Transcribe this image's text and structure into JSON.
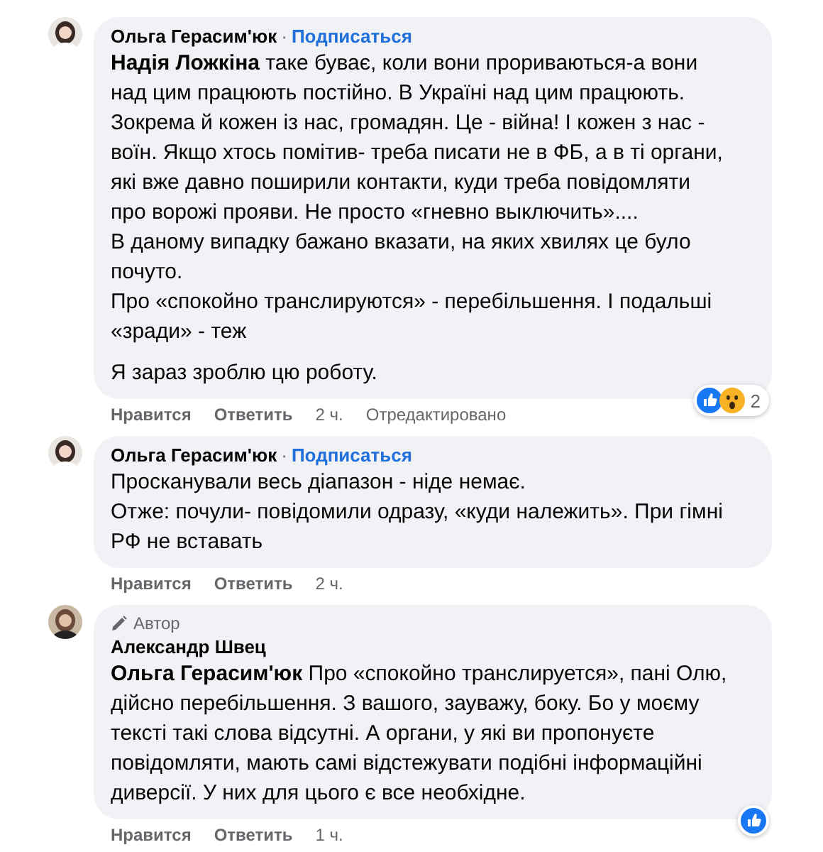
{
  "comments": [
    {
      "author": "Ольга Герасим'юк",
      "separator": "·",
      "follow": "Подписаться",
      "blocks": [
        [
          "**Надія Ложкіна** таке буває, коли вони прориваються-а вони над цим працюють постійно. В Україні над цим працюють. Зокрема й кожен із нас, громадян. Це - війна! І кожен з нас - воїн. Якщо хтось помітив- треба писати не в ФБ, а в ті органи, які вже давно поширили контакти, куди треба повідомляти про ворожі прояви. Не просто «гневно выключить»....",
          "В даному випадку бажано вказати, на яких хвилях це було почуто.",
          "Про «спокойно транслируются» - перебільшення. І подальші «зради» - теж"
        ],
        [
          "Я зараз зроблю цю роботу."
        ]
      ],
      "reactions": {
        "items": [
          {
            "kind": "like"
          },
          {
            "kind": "wow"
          }
        ],
        "count": "2"
      },
      "actions": [
        "Нравится",
        "Ответить"
      ],
      "time": "2 ч.",
      "edited": "Отредактировано"
    },
    {
      "author": "Ольга Герасим'юк",
      "separator": "·",
      "follow": "Подписаться",
      "blocks": [
        [
          "Просканували весь діапазон - ніде немає.",
          "Отже: почули- повідомили одразу, «куди належить». При гімні РФ не вставать"
        ]
      ],
      "actions": [
        "Нравится",
        "Ответить"
      ],
      "time": "2 ч."
    },
    {
      "author": "Александр Швец",
      "author_badge": "Автор",
      "blocks": [
        [
          "**Ольга Герасим'юк** Про «спокойно транслируется», пані Олю, дійсно перебільшення. З вашого, зауважу, боку. Бо у моєму тексті такі слова відсутні. А органи, у які ви пропонуєте повідомляти, мають самі відстежувати подібні інформаційні диверсії. У них для цього є все необхідне."
        ]
      ],
      "reactions": {
        "items": [
          {
            "kind": "like"
          }
        ]
      },
      "actions": [
        "Нравится",
        "Ответить"
      ],
      "time": "1 ч."
    }
  ]
}
